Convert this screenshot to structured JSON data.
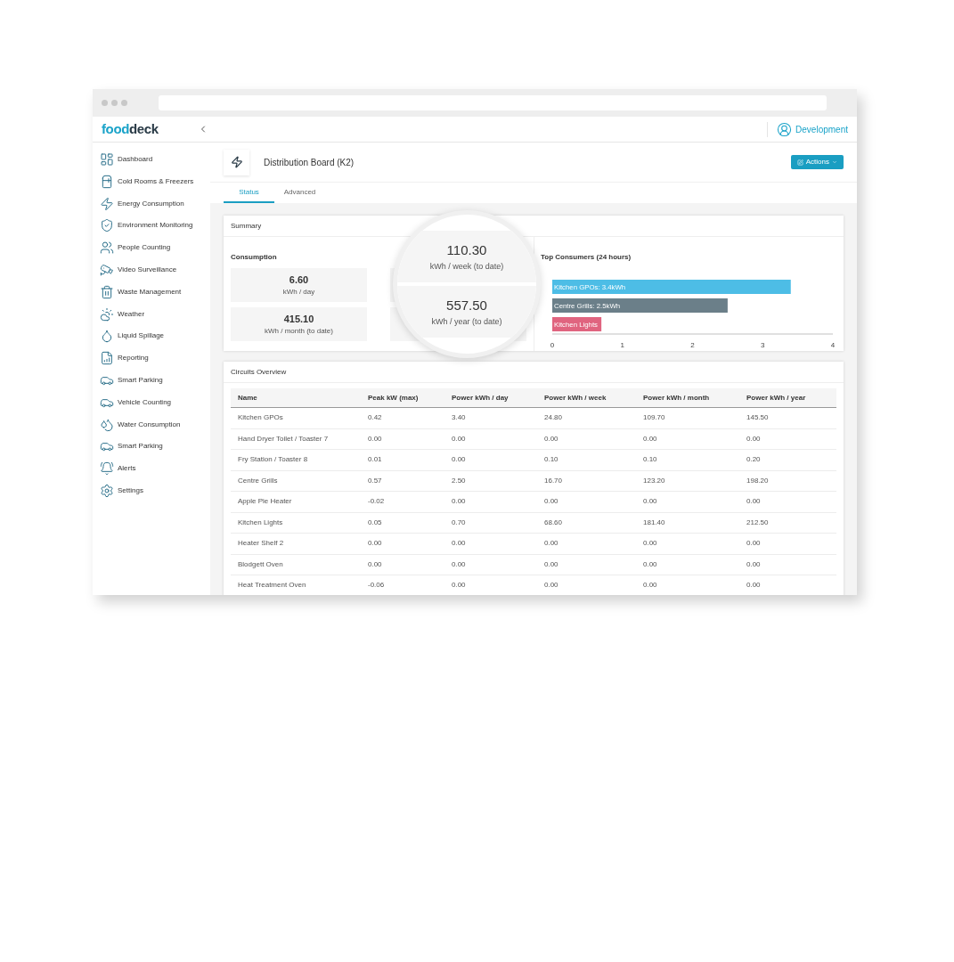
{
  "brand": {
    "logo_left": "food",
    "logo_right": "deck"
  },
  "user": {
    "name": "Development"
  },
  "sidebar": {
    "items": [
      {
        "label": "Dashboard"
      },
      {
        "label": "Cold Rooms & Freezers"
      },
      {
        "label": "Energy Consumption"
      },
      {
        "label": "Environment Monitoring"
      },
      {
        "label": "People Counting"
      },
      {
        "label": "Video Surveillance"
      },
      {
        "label": "Waste Management"
      },
      {
        "label": "Weather"
      },
      {
        "label": "Liquid Spillage"
      },
      {
        "label": "Reporting"
      },
      {
        "label": "Smart Parking"
      },
      {
        "label": "Vehicle Counting"
      },
      {
        "label": "Water Consumption"
      },
      {
        "label": "Smart Parking"
      },
      {
        "label": "Alerts"
      },
      {
        "label": "Settings"
      }
    ]
  },
  "page": {
    "title": "Distribution Board (K2)",
    "actions_button": "Actions"
  },
  "tabs": [
    {
      "label": "Status",
      "selected": true
    },
    {
      "label": "Advanced",
      "selected": false
    }
  ],
  "summary": {
    "title": "Summary",
    "consumption_title": "Consumption",
    "stats": [
      {
        "value": "6.60",
        "unit": "kWh / day",
        "magnified": false
      },
      {
        "value": "110.30",
        "unit": "kWh / week (to date)",
        "magnified": true
      },
      {
        "value": "415.10",
        "unit": "kWh / month (to date)",
        "magnified": false
      },
      {
        "value": "557.50",
        "unit": "kWh / year (to date)",
        "magnified": true
      }
    ],
    "chart_data": {
      "type": "bar",
      "title": "Top Consumers (24 hours)",
      "orientation": "horizontal",
      "values": [
        3.4,
        2.5,
        0.7
      ],
      "colors": [
        "#4dbde6",
        "#6b7f89",
        "#e0647f"
      ],
      "value_labels": [
        "Kitchen GPOs: 3.4kWh",
        "Centre Grills: 2.5kWh",
        "Kitchen Lights"
      ],
      "xlim": [
        0,
        4
      ],
      "xticks": [
        {
          "value": 0,
          "label": "0"
        },
        {
          "value": 1,
          "label": "1"
        },
        {
          "value": 2,
          "label": "2"
        },
        {
          "value": 3,
          "label": "3"
        },
        {
          "value": 4,
          "label": "4"
        }
      ]
    }
  },
  "circuits": {
    "title": "Circuits Overview",
    "columns": [
      "Name",
      "Peak kW (max)",
      "Power kWh / day",
      "Power kWh / week",
      "Power kWh / month",
      "Power kWh / year"
    ],
    "rows": [
      [
        "Kitchen GPOs",
        "0.42",
        "3.40",
        "24.80",
        "109.70",
        "145.50"
      ],
      [
        "Hand Dryer Toilet / Toaster 7",
        "0.00",
        "0.00",
        "0.00",
        "0.00",
        "0.00"
      ],
      [
        "Fry Station / Toaster 8",
        "0.01",
        "0.00",
        "0.10",
        "0.10",
        "0.20"
      ],
      [
        "Centre Grills",
        "0.57",
        "2.50",
        "16.70",
        "123.20",
        "198.20"
      ],
      [
        "Apple Pie Heater",
        "-0.02",
        "0.00",
        "0.00",
        "0.00",
        "0.00"
      ],
      [
        "Kitchen Lights",
        "0.05",
        "0.70",
        "68.60",
        "181.40",
        "212.50"
      ],
      [
        "Heater Shelf 2",
        "0.00",
        "0.00",
        "0.00",
        "0.00",
        "0.00"
      ],
      [
        "Blodgett Oven",
        "0.00",
        "0.00",
        "0.00",
        "0.00",
        "0.00"
      ],
      [
        "Heat Treatment Oven",
        "-0.06",
        "0.00",
        "0.00",
        "0.00",
        "0.00"
      ]
    ]
  }
}
